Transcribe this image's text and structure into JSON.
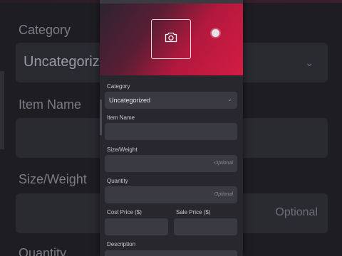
{
  "form": {
    "category_label": "Category",
    "category_value": "Uncategorized",
    "item_name_label": "Item Name",
    "item_name_value": "",
    "size_label": "Size/Weight",
    "size_placeholder": "Optional",
    "quantity_label": "Quantity",
    "quantity_placeholder": "Optional",
    "cost_label": "Cost Price ($)",
    "sale_label": "Sale Price ($)",
    "description_label": "Description"
  },
  "background": {
    "category_label": "Category",
    "category_value": "Uncategoriz",
    "item_name_label": "Item Name",
    "size_label": "Size/Weight",
    "optional": "Optional",
    "quantity_label": "Quantity"
  },
  "icons": {
    "photo": "camera-icon",
    "dropdown": "chevron-down-icon"
  },
  "colors": {
    "accent": "#d41c45",
    "field_bg": "#3a3a43",
    "panel_bg": "#27272d"
  }
}
